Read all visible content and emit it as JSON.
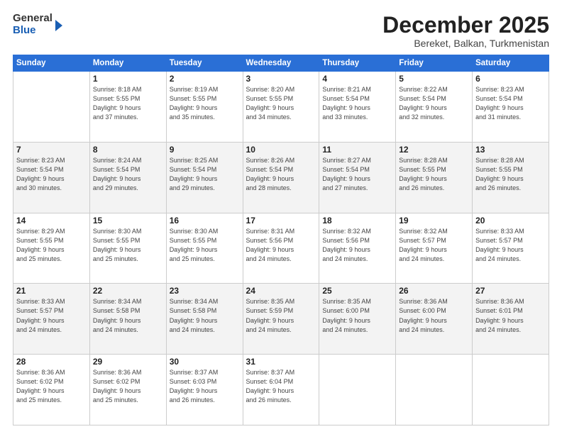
{
  "header": {
    "logo_general": "General",
    "logo_blue": "Blue",
    "month_year": "December 2025",
    "location": "Bereket, Balkan, Turkmenistan"
  },
  "days_of_week": [
    "Sunday",
    "Monday",
    "Tuesday",
    "Wednesday",
    "Thursday",
    "Friday",
    "Saturday"
  ],
  "weeks": [
    [
      {
        "day": "",
        "info": ""
      },
      {
        "day": "1",
        "info": "Sunrise: 8:18 AM\nSunset: 5:55 PM\nDaylight: 9 hours\nand 37 minutes."
      },
      {
        "day": "2",
        "info": "Sunrise: 8:19 AM\nSunset: 5:55 PM\nDaylight: 9 hours\nand 35 minutes."
      },
      {
        "day": "3",
        "info": "Sunrise: 8:20 AM\nSunset: 5:55 PM\nDaylight: 9 hours\nand 34 minutes."
      },
      {
        "day": "4",
        "info": "Sunrise: 8:21 AM\nSunset: 5:54 PM\nDaylight: 9 hours\nand 33 minutes."
      },
      {
        "day": "5",
        "info": "Sunrise: 8:22 AM\nSunset: 5:54 PM\nDaylight: 9 hours\nand 32 minutes."
      },
      {
        "day": "6",
        "info": "Sunrise: 8:23 AM\nSunset: 5:54 PM\nDaylight: 9 hours\nand 31 minutes."
      }
    ],
    [
      {
        "day": "7",
        "info": "Sunrise: 8:23 AM\nSunset: 5:54 PM\nDaylight: 9 hours\nand 30 minutes."
      },
      {
        "day": "8",
        "info": "Sunrise: 8:24 AM\nSunset: 5:54 PM\nDaylight: 9 hours\nand 29 minutes."
      },
      {
        "day": "9",
        "info": "Sunrise: 8:25 AM\nSunset: 5:54 PM\nDaylight: 9 hours\nand 29 minutes."
      },
      {
        "day": "10",
        "info": "Sunrise: 8:26 AM\nSunset: 5:54 PM\nDaylight: 9 hours\nand 28 minutes."
      },
      {
        "day": "11",
        "info": "Sunrise: 8:27 AM\nSunset: 5:54 PM\nDaylight: 9 hours\nand 27 minutes."
      },
      {
        "day": "12",
        "info": "Sunrise: 8:28 AM\nSunset: 5:55 PM\nDaylight: 9 hours\nand 26 minutes."
      },
      {
        "day": "13",
        "info": "Sunrise: 8:28 AM\nSunset: 5:55 PM\nDaylight: 9 hours\nand 26 minutes."
      }
    ],
    [
      {
        "day": "14",
        "info": "Sunrise: 8:29 AM\nSunset: 5:55 PM\nDaylight: 9 hours\nand 25 minutes."
      },
      {
        "day": "15",
        "info": "Sunrise: 8:30 AM\nSunset: 5:55 PM\nDaylight: 9 hours\nand 25 minutes."
      },
      {
        "day": "16",
        "info": "Sunrise: 8:30 AM\nSunset: 5:55 PM\nDaylight: 9 hours\nand 25 minutes."
      },
      {
        "day": "17",
        "info": "Sunrise: 8:31 AM\nSunset: 5:56 PM\nDaylight: 9 hours\nand 24 minutes."
      },
      {
        "day": "18",
        "info": "Sunrise: 8:32 AM\nSunset: 5:56 PM\nDaylight: 9 hours\nand 24 minutes."
      },
      {
        "day": "19",
        "info": "Sunrise: 8:32 AM\nSunset: 5:57 PM\nDaylight: 9 hours\nand 24 minutes."
      },
      {
        "day": "20",
        "info": "Sunrise: 8:33 AM\nSunset: 5:57 PM\nDaylight: 9 hours\nand 24 minutes."
      }
    ],
    [
      {
        "day": "21",
        "info": "Sunrise: 8:33 AM\nSunset: 5:57 PM\nDaylight: 9 hours\nand 24 minutes."
      },
      {
        "day": "22",
        "info": "Sunrise: 8:34 AM\nSunset: 5:58 PM\nDaylight: 9 hours\nand 24 minutes."
      },
      {
        "day": "23",
        "info": "Sunrise: 8:34 AM\nSunset: 5:58 PM\nDaylight: 9 hours\nand 24 minutes."
      },
      {
        "day": "24",
        "info": "Sunrise: 8:35 AM\nSunset: 5:59 PM\nDaylight: 9 hours\nand 24 minutes."
      },
      {
        "day": "25",
        "info": "Sunrise: 8:35 AM\nSunset: 6:00 PM\nDaylight: 9 hours\nand 24 minutes."
      },
      {
        "day": "26",
        "info": "Sunrise: 8:36 AM\nSunset: 6:00 PM\nDaylight: 9 hours\nand 24 minutes."
      },
      {
        "day": "27",
        "info": "Sunrise: 8:36 AM\nSunset: 6:01 PM\nDaylight: 9 hours\nand 24 minutes."
      }
    ],
    [
      {
        "day": "28",
        "info": "Sunrise: 8:36 AM\nSunset: 6:02 PM\nDaylight: 9 hours\nand 25 minutes."
      },
      {
        "day": "29",
        "info": "Sunrise: 8:36 AM\nSunset: 6:02 PM\nDaylight: 9 hours\nand 25 minutes."
      },
      {
        "day": "30",
        "info": "Sunrise: 8:37 AM\nSunset: 6:03 PM\nDaylight: 9 hours\nand 26 minutes."
      },
      {
        "day": "31",
        "info": "Sunrise: 8:37 AM\nSunset: 6:04 PM\nDaylight: 9 hours\nand 26 minutes."
      },
      {
        "day": "",
        "info": ""
      },
      {
        "day": "",
        "info": ""
      },
      {
        "day": "",
        "info": ""
      }
    ]
  ]
}
